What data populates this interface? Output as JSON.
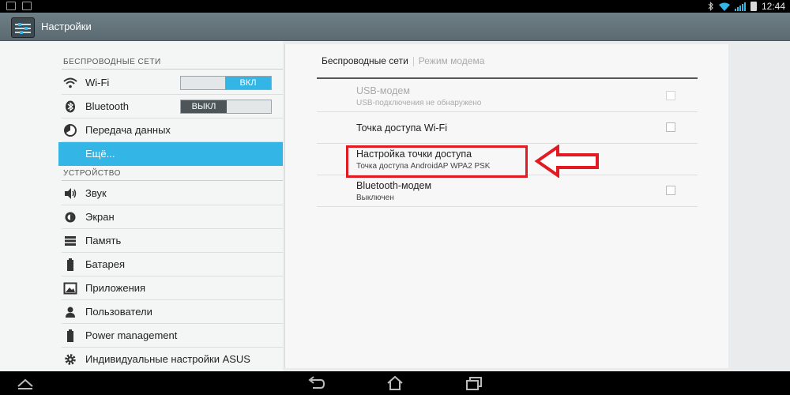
{
  "actionbar": {
    "title": "Настройки"
  },
  "status": {
    "time": "12:44"
  },
  "sidebar": {
    "section_wireless": "БЕСПРОВОДНЫЕ СЕТИ",
    "section_device": "УСТРОЙСТВО",
    "items": [
      {
        "label": "Wi-Fi",
        "icon": "wifi-icon",
        "toggle": "ВКЛ"
      },
      {
        "label": "Bluetooth",
        "icon": "bluetooth-icon",
        "toggle": "ВЫКЛ"
      },
      {
        "label": "Передача данных",
        "icon": "data-usage-icon"
      },
      {
        "label": "Ещё...",
        "selected": true
      },
      {
        "label": "Звук",
        "icon": "sound-icon"
      },
      {
        "label": "Экран",
        "icon": "display-icon"
      },
      {
        "label": "Память",
        "icon": "storage-icon"
      },
      {
        "label": "Батарея",
        "icon": "battery-icon"
      },
      {
        "label": "Приложения",
        "icon": "apps-icon"
      },
      {
        "label": "Пользователи",
        "icon": "users-icon"
      },
      {
        "label": "Power management",
        "icon": "power-icon"
      },
      {
        "label": "Индивидуальные настройки ASUS",
        "icon": "gear-icon"
      }
    ]
  },
  "tabs": {
    "active": "Беспроводные сети",
    "inactive": "Режим модема"
  },
  "prefs": [
    {
      "title": "USB-модем",
      "summary": "USB-подключения не обнаружено",
      "disabled": true
    },
    {
      "title": "Точка доступа Wi-Fi",
      "summary": ""
    },
    {
      "title": "Настройка точки доступа",
      "summary": "Точка доступа AndroidAP WPA2 PSK"
    },
    {
      "title": "Bluetooth-модем",
      "summary": "Выключен"
    }
  ],
  "colors": {
    "accent": "#33b5e5",
    "highlight": "#e21b23"
  }
}
